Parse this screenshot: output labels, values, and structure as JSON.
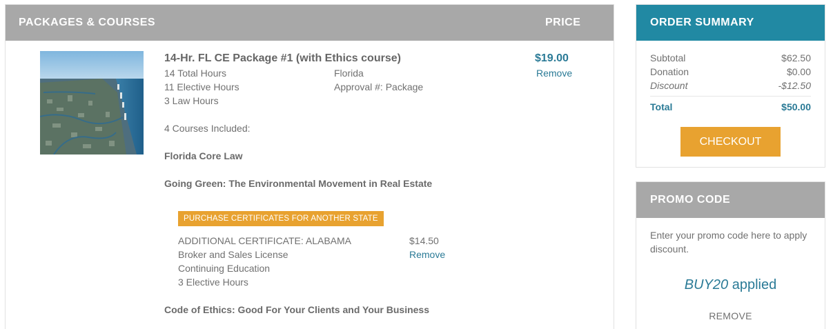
{
  "packages": {
    "header_title": "PACKAGES & COURSES",
    "header_price": "PRICE",
    "item": {
      "title": "14-Hr. FL CE Package #1 (with Ethics course)",
      "total_hours": "14 Total Hours",
      "elective_hours": "11 Elective Hours",
      "law_hours": "3 Law Hours",
      "state": "Florida",
      "approval": "Approval #: Package",
      "price": "$19.00",
      "remove_label": "Remove",
      "courses_included": "4 Courses Included:",
      "courses": [
        "Florida Core Law",
        "Going Green: The Environmental Movement in Real Estate",
        "Code of Ethics: Good For Your Clients and Your Business"
      ],
      "cert_button_label": "PURCHASE CERTIFICATES FOR ANOTHER STATE",
      "additional_cert": {
        "title": "ADDITIONAL CERTIFICATE: ALABAMA",
        "license": "Broker and Sales License",
        "type": "Continuing Education",
        "hours": "3 Elective Hours",
        "price": "$14.50",
        "remove_label": "Remove"
      }
    }
  },
  "order_summary": {
    "title": "ORDER SUMMARY",
    "subtotal_label": "Subtotal",
    "subtotal_value": "$62.50",
    "donation_label": "Donation",
    "donation_value": "$0.00",
    "discount_label": "Discount",
    "discount_value": "-$12.50",
    "total_label": "Total",
    "total_value": "$50.00",
    "checkout_label": "CHECKOUT"
  },
  "promo": {
    "title": "PROMO CODE",
    "instructions": "Enter your promo code here to apply discount.",
    "code": "BUY20",
    "applied_suffix": " applied",
    "remove_label": "REMOVE"
  },
  "colors": {
    "accent_teal": "#2189a3",
    "link_blue": "#2a7a96",
    "orange": "#e8a230",
    "header_gray": "#a8a8a8"
  }
}
